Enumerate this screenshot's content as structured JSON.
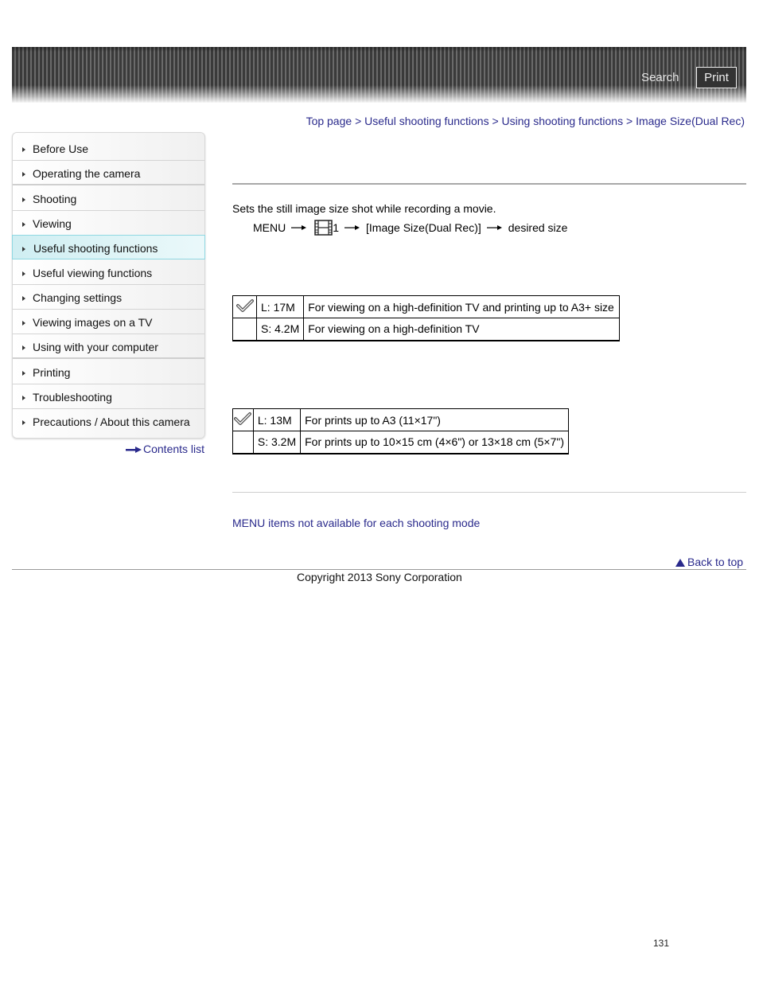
{
  "header": {
    "search_label": "Search",
    "print_label": "Print"
  },
  "breadcrumb": {
    "items": [
      "Top page",
      "Useful shooting functions",
      "Using shooting functions",
      "Image Size(Dual Rec)"
    ],
    "separator": ">"
  },
  "sidebar": {
    "items": [
      {
        "label": "Before Use"
      },
      {
        "label": "Operating the camera"
      },
      {
        "label": "Shooting"
      },
      {
        "label": "Viewing"
      },
      {
        "label": "Useful shooting functions",
        "active": true
      },
      {
        "label": "Useful viewing functions"
      },
      {
        "label": "Changing settings"
      },
      {
        "label": "Viewing images on a TV"
      },
      {
        "label": "Using with your computer"
      },
      {
        "label": "Printing"
      },
      {
        "label": "Troubleshooting"
      },
      {
        "label": "Precautions / About this camera"
      }
    ],
    "contents_list_label": "Contents list"
  },
  "main": {
    "description": "Sets the still image size shot while recording a movie.",
    "menu_path": {
      "menu": "MENU",
      "tab_icon": "movie-film-icon",
      "tab_number": "1",
      "item": "[Image Size(Dual Rec)]",
      "final": "desired size"
    },
    "table1": {
      "rows": [
        {
          "default": true,
          "size": "L: 17M",
          "description": "For viewing on a high-definition TV and printing up to A3+ size"
        },
        {
          "default": false,
          "size": "S: 4.2M",
          "description": "For viewing on a high-definition TV"
        }
      ]
    },
    "table2": {
      "rows": [
        {
          "default": true,
          "size": "L: 13M",
          "description": "For prints up to A3 (11×17\")"
        },
        {
          "default": false,
          "size": "S: 3.2M",
          "description": "For prints up to 10×15 cm (4×6\") or 13×18 cm (5×7\")"
        }
      ]
    },
    "related_link": "MENU items not available for each shooting mode",
    "back_to_top": "Back to top"
  },
  "footer": {
    "copyright": "Copyright 2013 Sony Corporation",
    "page_number": "131"
  },
  "colors": {
    "link": "#2a2a8c",
    "active_sidebar": "#dff4f7"
  }
}
